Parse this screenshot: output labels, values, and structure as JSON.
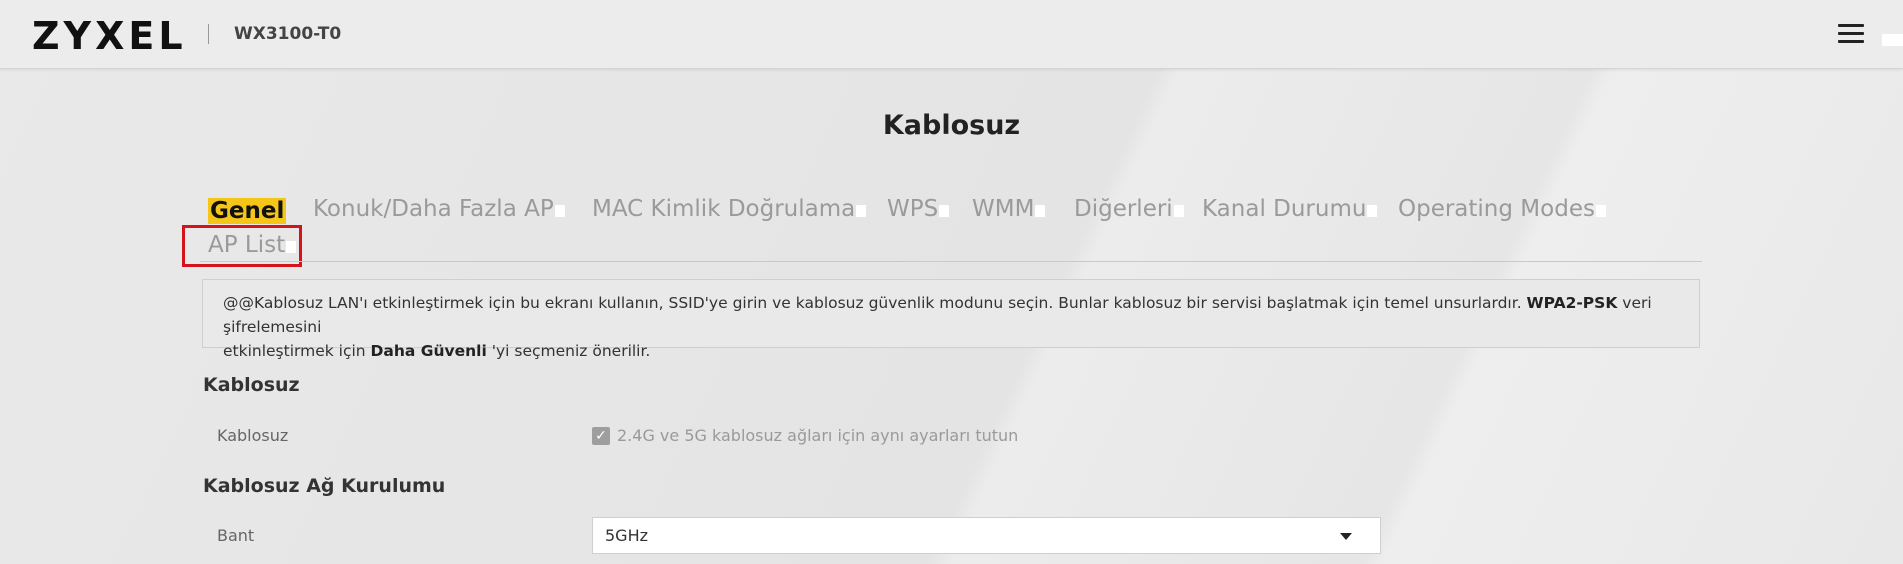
{
  "header": {
    "brand": "ZYXEL",
    "model": "WX3100-T0",
    "menu_icon": "hamburger-menu-icon"
  },
  "page": {
    "title": "Kablosuz"
  },
  "tabs": [
    {
      "label": "Genel",
      "active": true
    },
    {
      "label": "Konuk/Daha Fazla AP",
      "active": false
    },
    {
      "label": "MAC Kimlik Doğrulama",
      "active": false
    },
    {
      "label": "WPS",
      "active": false
    },
    {
      "label": "WMM",
      "active": false
    },
    {
      "label": "Diğerleri",
      "active": false
    },
    {
      "label": "Kanal Durumu",
      "active": false
    },
    {
      "label": "Operating Modes",
      "active": false
    },
    {
      "label": "AP List",
      "active": false
    }
  ],
  "info": {
    "text_1": "@@Kablosuz LAN'ı etkinleştirmek için bu ekranı kullanın, SSID'ye girin ve kablosuz güvenlik modunu seçin. Bunlar kablosuz bir servisi başlatmak için temel unsurlardır. ",
    "bold_1": "WPA2-PSK",
    "text_2": " veri şifrelemesini",
    "text_3": "etkinleştirmek için ",
    "bold_2": "Daha Güvenli",
    "text_4": " 'yi seçmeniz önerilir."
  },
  "sections": {
    "wireless": {
      "title": "Kablosuz",
      "label": "Kablosuz",
      "checkbox_label": "2.4G ve 5G kablosuz ağları için aynı ayarları tutun",
      "checked": true
    },
    "network_setup": {
      "title": "Kablosuz Ağ Kurulumu",
      "band_label": "Bant",
      "band_value": "5GHz"
    }
  },
  "colors": {
    "accent_highlight": "#f5c518",
    "annotation_box": "#d4141c"
  }
}
